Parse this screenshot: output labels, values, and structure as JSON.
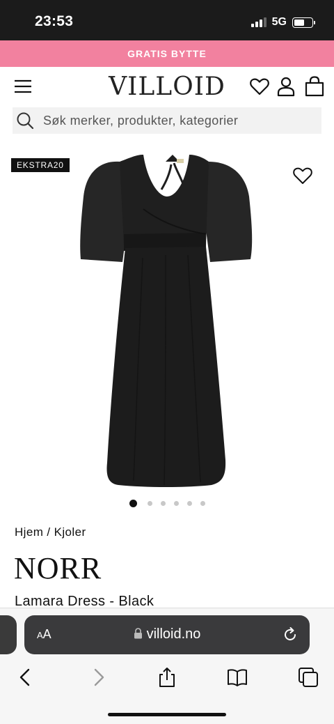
{
  "status_bar": {
    "time": "23:53",
    "network": "5G",
    "signal_bars_active": 3,
    "signal_bars_total": 4,
    "battery_level": 0.6
  },
  "promo": {
    "text": "GRATIS BYTTE",
    "bg_color": "#f2819f"
  },
  "header": {
    "logo": "VILLOID",
    "icons": [
      "menu-icon",
      "heart-icon",
      "user-icon",
      "shopping-bag-icon"
    ]
  },
  "search": {
    "placeholder": "Søk merker, produkter, kategorier"
  },
  "product": {
    "badge": "EKSTRA20",
    "breadcrumb": "Hjem / Kjoler",
    "brand": "NORR",
    "name": "Lamara Dress - Black",
    "carousel": {
      "total": 6,
      "active": 0
    }
  },
  "browser": {
    "text_size_label_small": "A",
    "text_size_label_large": "A",
    "url": "villoid.no",
    "toolbar_icons": [
      "back-icon",
      "forward-icon",
      "share-icon",
      "bookmarks-icon",
      "tabs-icon"
    ]
  },
  "colors": {
    "accent_pink": "#f2819f",
    "text": "#111111",
    "chrome_dark": "#3a3a3c"
  }
}
